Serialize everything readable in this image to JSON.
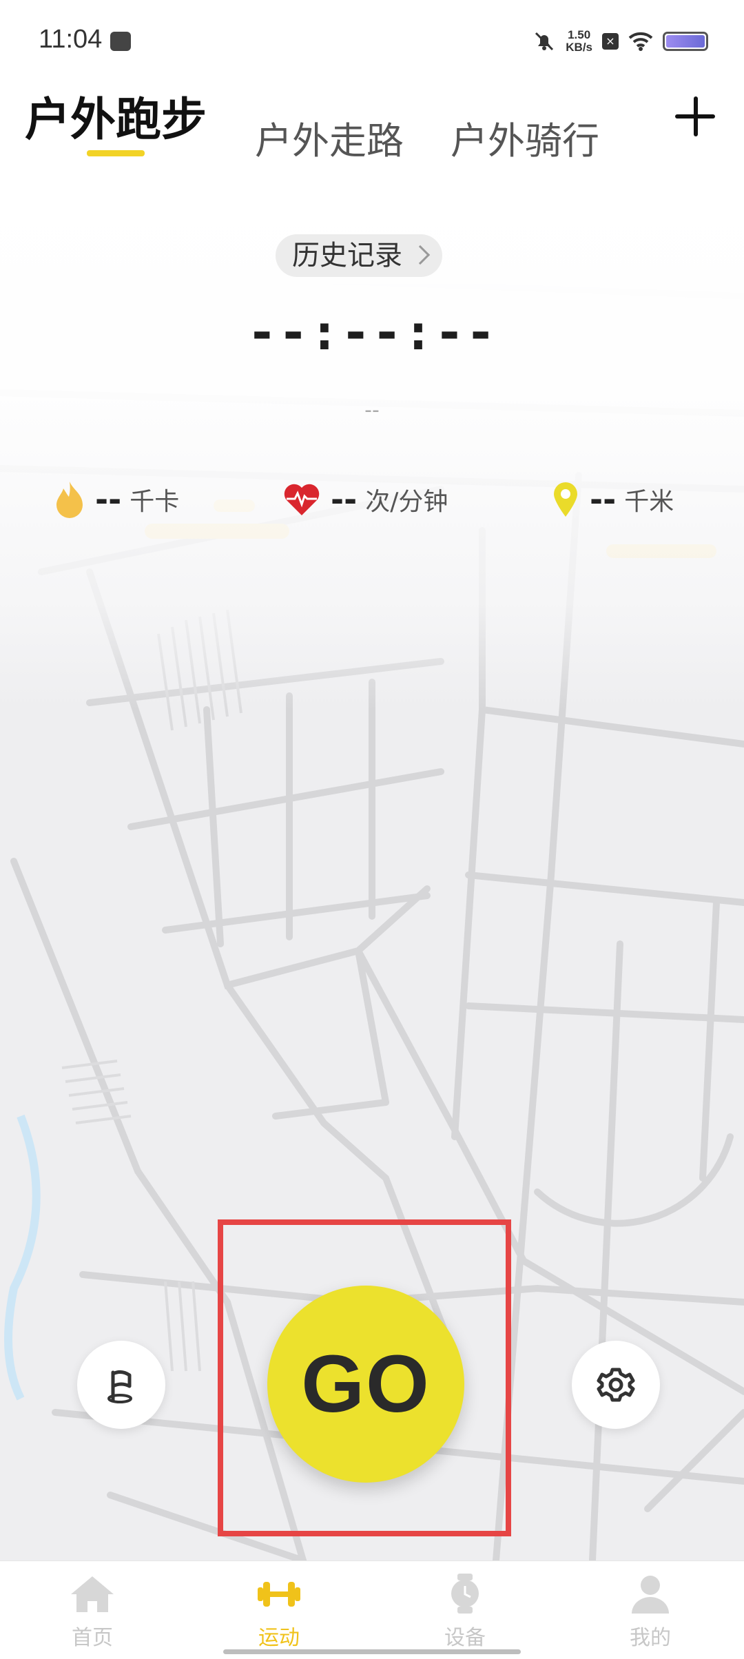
{
  "status_bar": {
    "time": "11:04",
    "net_speed_value": "1.50",
    "net_speed_unit": "KB/s"
  },
  "tabs": [
    {
      "label": "户外跑步",
      "active": true
    },
    {
      "label": "户外走路",
      "active": false
    },
    {
      "label": "户外骑行",
      "active": false
    }
  ],
  "add_icon": "plus-icon",
  "history_label": "历史记录",
  "timer": "--:--:--",
  "sub_value": "--",
  "stats": {
    "calories": {
      "value": "--",
      "unit": "千卡",
      "icon": "flame-icon"
    },
    "heart_rate": {
      "value": "--",
      "unit": "次/分钟",
      "icon": "heart-rate-icon"
    },
    "distance": {
      "value": "--",
      "unit": "千米",
      "icon": "location-pin-icon"
    }
  },
  "go_label": "GO",
  "nav": [
    {
      "label": "首页",
      "icon": "home-icon",
      "active": false
    },
    {
      "label": "运动",
      "icon": "dumbbell-icon",
      "active": true
    },
    {
      "label": "设备",
      "icon": "watch-icon",
      "active": false
    },
    {
      "label": "我的",
      "icon": "person-icon",
      "active": false
    }
  ],
  "colors": {
    "accent": "#ece12d",
    "tab_underline": "#f2d327",
    "nav_active": "#f0c21a",
    "highlight": "#e64545",
    "heart": "#d9262e"
  }
}
